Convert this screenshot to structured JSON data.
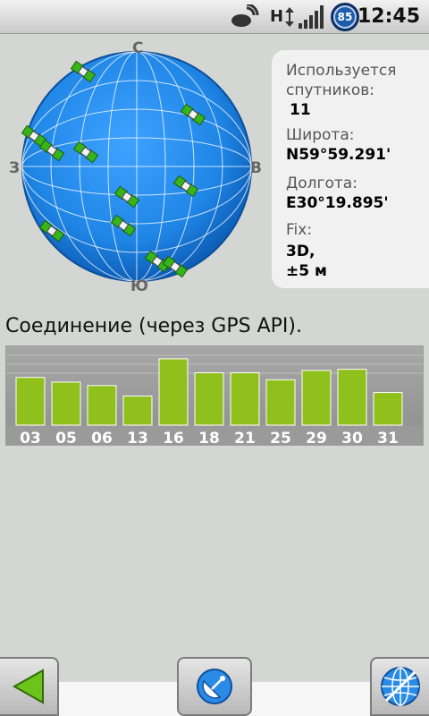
{
  "status_bar": {
    "time": "12:45",
    "battery_level": "85",
    "network_type": "H",
    "icons": [
      "nfc-icon",
      "network-arrows-icon",
      "signal-icon",
      "battery-icon"
    ]
  },
  "sky_view": {
    "compass": {
      "north": "С",
      "south": "Ю",
      "west": "З",
      "east": "В"
    },
    "sphere_color": "#1f86e6",
    "satellite_color": "#37b41a"
  },
  "info": {
    "satellites_label": "Используется спутников:",
    "satellites_value": "11",
    "latitude_label": "Широта:",
    "latitude_value": "N59°59.291'",
    "longitude_label": "Долгота:",
    "longitude_value": "E30°19.895'",
    "fix_label": "Fix:",
    "fix_value_line1": "3D,",
    "fix_value_line2": "±5 м"
  },
  "connection": {
    "text": "Соединение (через GPS API)."
  },
  "chart_data": {
    "type": "bar",
    "categories": [
      "03",
      "05",
      "06",
      "13",
      "16",
      "18",
      "21",
      "25",
      "29",
      "30",
      "31"
    ],
    "values": [
      41,
      37,
      34,
      25,
      57,
      45,
      45,
      39,
      47,
      48,
      28
    ],
    "ylim": [
      0,
      60
    ],
    "bar_color": "#90c01c",
    "grid": false
  },
  "bottom_bar": {
    "back_icon": "back-arrow-icon",
    "center_icon": "satellite-dish-icon",
    "right_icon": "globe-icon"
  }
}
